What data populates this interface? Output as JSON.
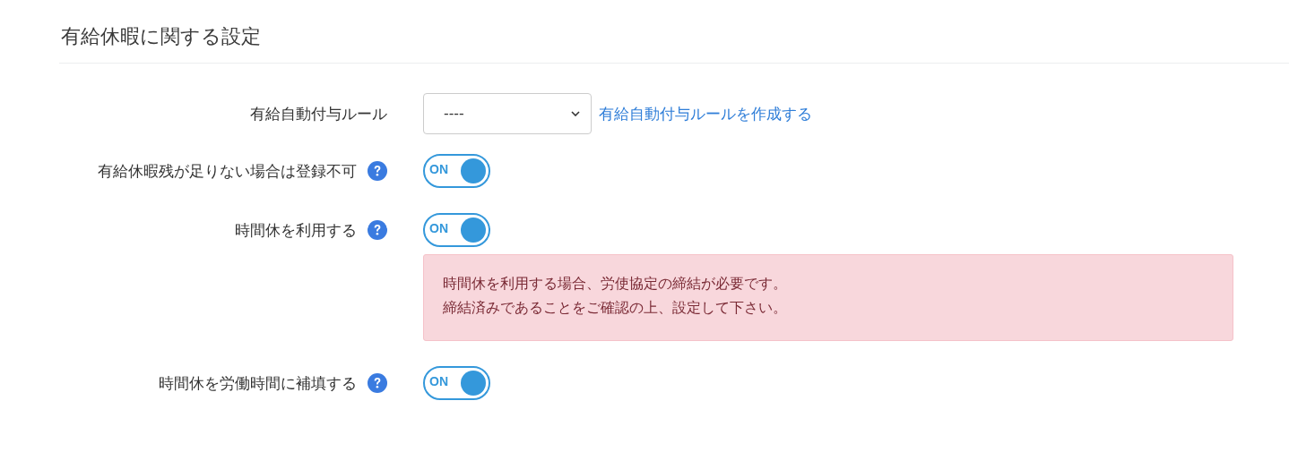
{
  "section": {
    "title": "有給休暇に関する設定"
  },
  "rows": [
    {
      "kind": "select",
      "label": "有給自動付与ルール",
      "value": "----",
      "link": "有給自動付与ルールを作成する"
    },
    {
      "kind": "toggle",
      "label": "有給休暇残が足りない場合は登録不可",
      "help": true,
      "on": true,
      "toggle_text": "ON"
    },
    {
      "kind": "toggle",
      "label": "時間休を利用する",
      "help": true,
      "on": true,
      "toggle_text": "ON",
      "alert": [
        "時間休を利用する場合、労使協定の締結が必要です。",
        "締結済みであることをご確認の上、設定して下さい。"
      ]
    },
    {
      "kind": "toggle",
      "label": "時間休を労働時間に補填する",
      "help": true,
      "on": true,
      "toggle_text": "ON"
    }
  ]
}
